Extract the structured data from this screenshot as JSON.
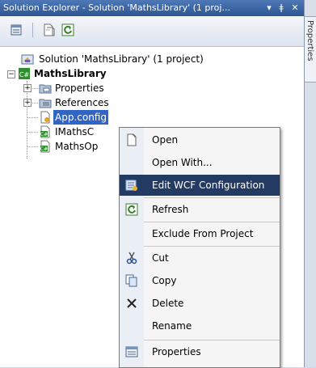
{
  "panel": {
    "title": "Solution Explorer - Solution 'MathsLibrary' (1 proj...",
    "dropdown_glyph": "▾",
    "pin_glyph": "ǂ",
    "close_glyph": "✕"
  },
  "side": {
    "tab_label": "Properties"
  },
  "tree": {
    "solution": "Solution 'MathsLibrary' (1 project)",
    "project": "MathsLibrary",
    "items": [
      {
        "label": "Properties",
        "icon": "properties-folder-icon"
      },
      {
        "label": "References",
        "icon": "references-folder-icon"
      },
      {
        "label": "App.config",
        "icon": "config-file-icon"
      },
      {
        "label": "IMathsC",
        "icon": "csharp-file-icon"
      },
      {
        "label": "MathsOp",
        "icon": "csharp-file-icon"
      }
    ]
  },
  "context_menu": {
    "items": [
      {
        "label": "Open",
        "icon": "open-icon"
      },
      {
        "label": "Open With...",
        "icon": ""
      },
      {
        "label": "Edit WCF Configuration",
        "icon": "wcf-config-icon",
        "highlighted": true
      },
      {
        "label": "Refresh",
        "icon": "refresh-icon"
      },
      {
        "label": "Exclude From Project",
        "icon": ""
      },
      {
        "label": "Cut",
        "icon": "scissors-icon"
      },
      {
        "label": "Copy",
        "icon": "copy-icon"
      },
      {
        "label": "Delete",
        "icon": "delete-x-icon"
      },
      {
        "label": "Rename",
        "icon": ""
      },
      {
        "label": "Properties",
        "icon": "properties-icon"
      }
    ]
  }
}
